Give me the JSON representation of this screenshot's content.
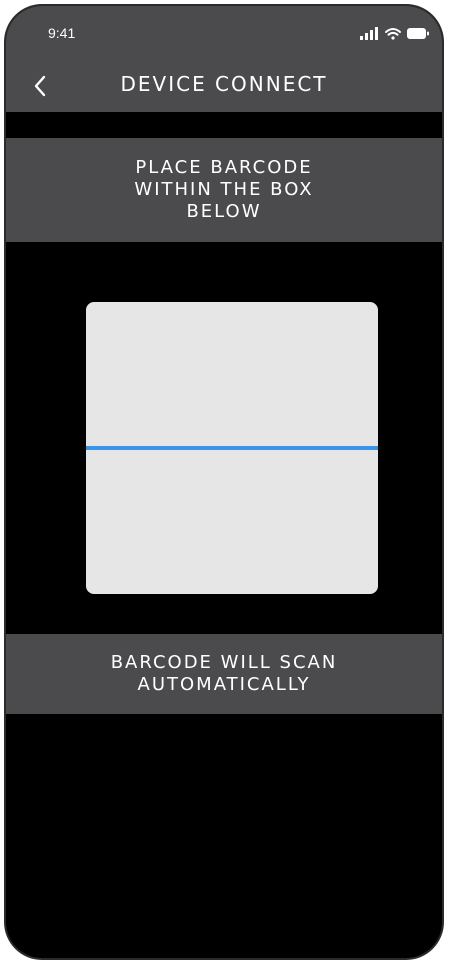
{
  "status_bar": {
    "time": "9:41",
    "icons": [
      "signal-icon",
      "wifi-icon",
      "battery-icon"
    ]
  },
  "nav": {
    "back_icon": "chevron-left-icon",
    "title": "DEVICE CONNECT"
  },
  "instruction": {
    "text": "PLACE BARCODE\nWITHIN THE BOX\nBELOW"
  },
  "scanner": {
    "box_color": "#e6e6e6",
    "line_color": "#3a95e6"
  },
  "footer_notice": {
    "text": "BARCODE WILL SCAN\nAUTOMATICALLY"
  },
  "colors": {
    "background": "#000000",
    "panel": "#4b4b4d",
    "text": "#ffffff"
  }
}
